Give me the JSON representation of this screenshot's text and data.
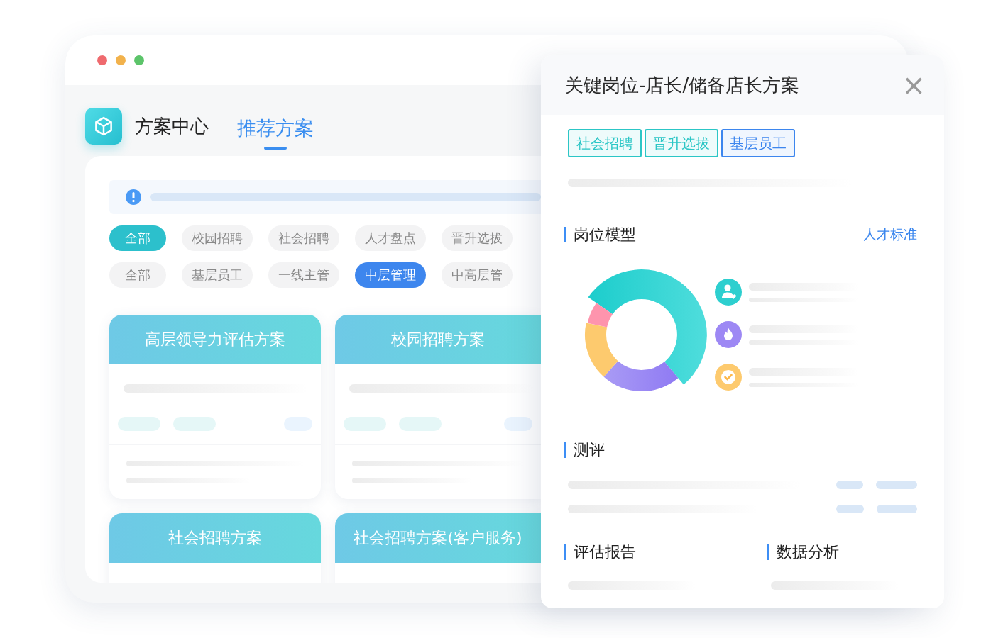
{
  "app": {
    "name": "方案中心",
    "tabs": [
      {
        "label": "推荐方案",
        "selected": true
      }
    ]
  },
  "filters": [
    {
      "kind": "scene",
      "chips": [
        {
          "label": "全部",
          "selected": true
        },
        {
          "label": "校园招聘",
          "selected": false
        },
        {
          "label": "社会招聘",
          "selected": false
        },
        {
          "label": "人才盘点",
          "selected": false
        },
        {
          "label": "晋升选拔",
          "selected": false
        }
      ]
    },
    {
      "kind": "level",
      "chips": [
        {
          "label": "全部",
          "selected": false
        },
        {
          "label": "基层员工",
          "selected": false
        },
        {
          "label": "一线主管",
          "selected": false
        },
        {
          "label": "中层管理",
          "selected": true
        },
        {
          "label": "中高层管",
          "selected": false
        }
      ]
    }
  ],
  "cards": [
    {
      "title": "高层领导力评估方案"
    },
    {
      "title": "校园招聘方案"
    },
    {
      "title": "社会招聘方案"
    },
    {
      "title": "社会招聘方案(客户服务)"
    }
  ],
  "panel": {
    "title": "关键岗位-店长/储备店长方案",
    "close": "×",
    "tags": [
      {
        "label": "社会招聘",
        "color": "#2cc6c6"
      },
      {
        "label": "晋升选拔",
        "color": "#2cc6c6"
      },
      {
        "label": "基层员工",
        "color": "#3d86ee"
      }
    ],
    "model": {
      "heading": "岗位模型",
      "link": "人才标准"
    },
    "assessment": {
      "heading": "测评"
    },
    "report": {
      "heading": "评估报告"
    },
    "analysis": {
      "heading": "数据分析"
    }
  }
}
